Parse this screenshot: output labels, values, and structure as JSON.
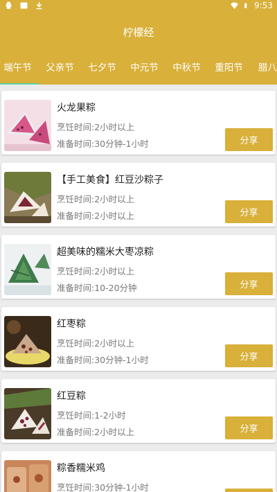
{
  "status_bar": {
    "time": "9:53",
    "left_icons": [
      "qq-icon",
      "notification-icon",
      "download-icon"
    ],
    "right_icons": [
      "wifi-icon",
      "battery-icon"
    ]
  },
  "header": {
    "title": "柠檬经"
  },
  "tabs": [
    {
      "label": "端午节",
      "selected": true
    },
    {
      "label": "父亲节",
      "selected": false
    },
    {
      "label": "七夕节",
      "selected": false
    },
    {
      "label": "中元节",
      "selected": false
    },
    {
      "label": "中秋节",
      "selected": false
    },
    {
      "label": "重阳节",
      "selected": false
    },
    {
      "label": "腊八",
      "selected": false
    }
  ],
  "share_label": "分享",
  "recipes": [
    {
      "title": "火龙果粽",
      "cook": "烹饪时间:2小时以上",
      "prep": "准备时间:30分钟-1小时",
      "thumb": "pink-zongzi-photo"
    },
    {
      "title": "【手工美食】红豆沙粽子",
      "cook": "烹饪时间:2小时以上",
      "prep": "准备时间:2小时以上",
      "thumb": "red-bean-zongzi-photo"
    },
    {
      "title": "超美味的糯米大枣凉粽",
      "cook": "烹饪时间:2小时以上",
      "prep": "准备时间:10-20分钟",
      "thumb": "green-zongzi-photo"
    },
    {
      "title": "红枣粽",
      "cook": "烹饪时间:2小时以上",
      "prep": "准备时间:30分钟-1小时",
      "thumb": "date-zongzi-photo"
    },
    {
      "title": "红豆粽",
      "cook": "烹饪时间:1-2小时",
      "prep": "准备时间:2小时以上",
      "thumb": "red-bean-zongzi-photo"
    },
    {
      "title": "粽香糯米鸡",
      "cook": "烹饪时间:30分钟-1小时",
      "prep": "",
      "thumb": "sticky-rice-chicken-photo"
    }
  ],
  "colors": {
    "brand": "#d8b03a",
    "tab_indicator": "#5fd39a",
    "background": "#ececec"
  }
}
